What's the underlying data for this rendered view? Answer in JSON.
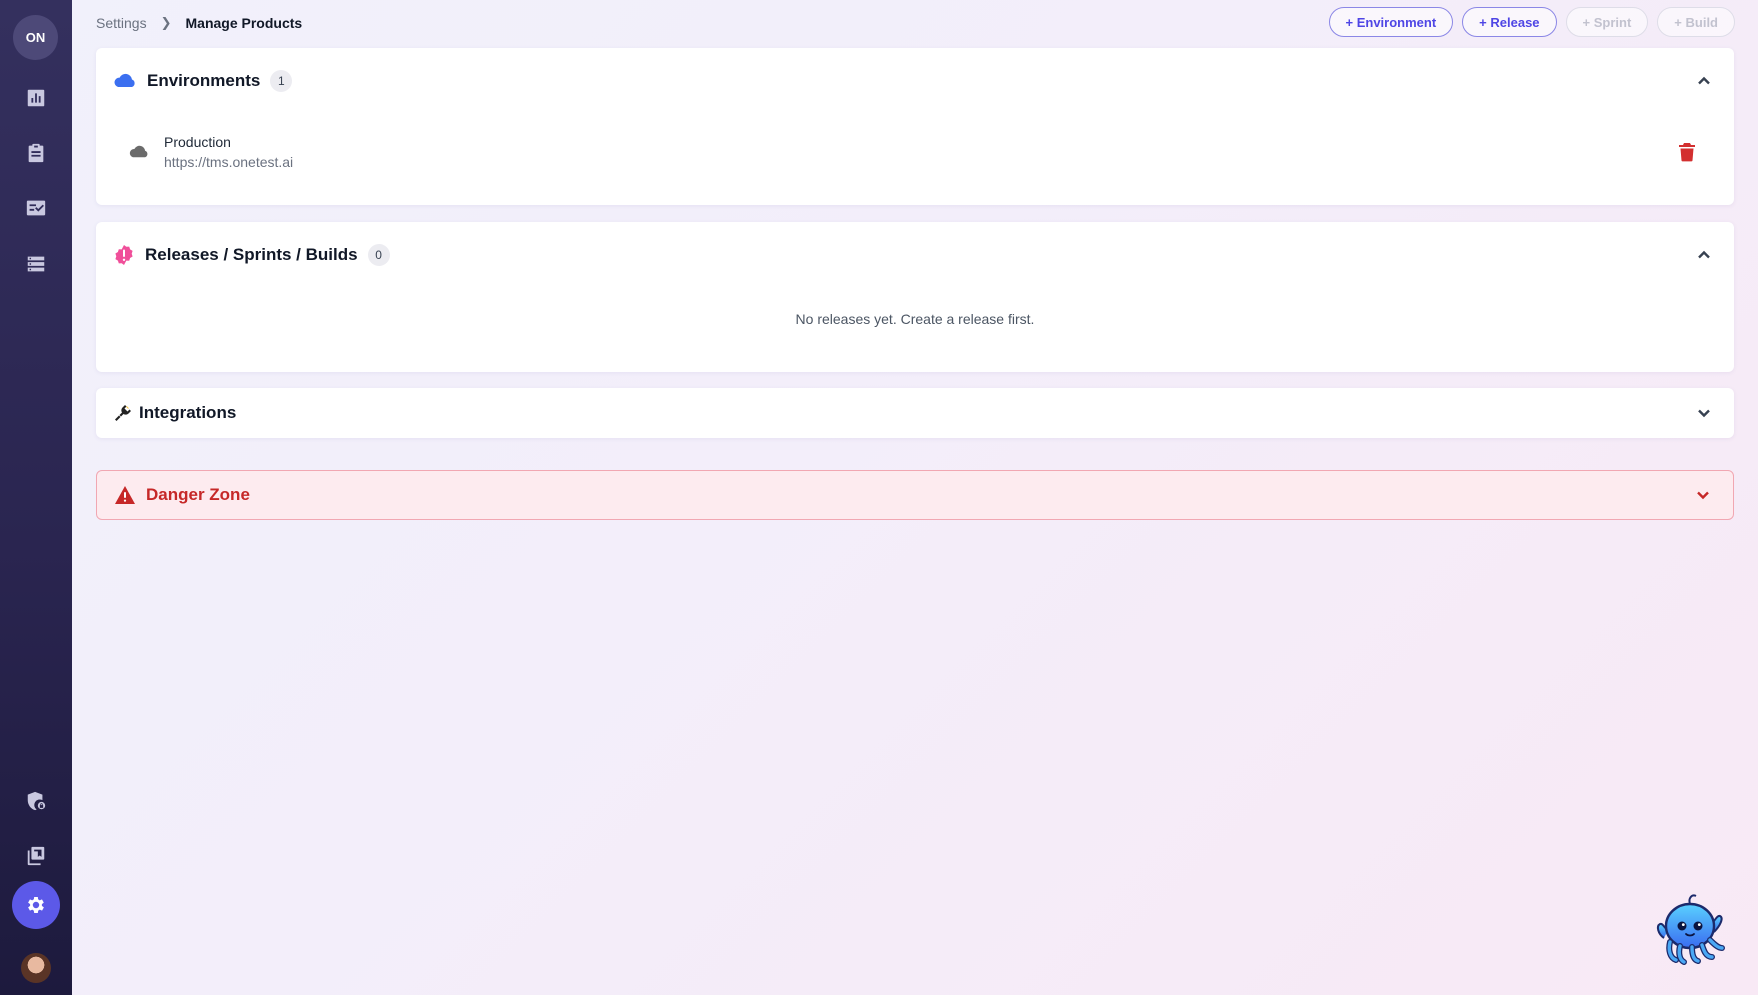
{
  "sidebar": {
    "workspace_initials": "ON",
    "nav": [
      {
        "icon": "bar-chart-icon"
      },
      {
        "icon": "clipboard-icon"
      },
      {
        "icon": "checklist-icon"
      },
      {
        "icon": "list-icon"
      }
    ],
    "bottom": [
      {
        "icon": "shield-lock-icon"
      },
      {
        "icon": "library-icon"
      },
      {
        "icon": "gear-icon",
        "active": true
      }
    ],
    "accent": "#5c59e8"
  },
  "breadcrumb": {
    "parent": "Settings",
    "current": "Manage Products"
  },
  "actions": {
    "environment": "+ Environment",
    "release": "+ Release",
    "sprint": "+ Sprint",
    "build": "+ Build"
  },
  "environments": {
    "title": "Environments",
    "count": "1",
    "items": [
      {
        "name": "Production",
        "url": "https://tms.onetest.ai"
      }
    ]
  },
  "releases": {
    "title": "Releases / Sprints / Builds",
    "count": "0",
    "empty_message": "No releases yet. Create a release first."
  },
  "integrations": {
    "title": "Integrations"
  },
  "danger_zone": {
    "title": "Danger Zone",
    "color": "#c62828"
  }
}
